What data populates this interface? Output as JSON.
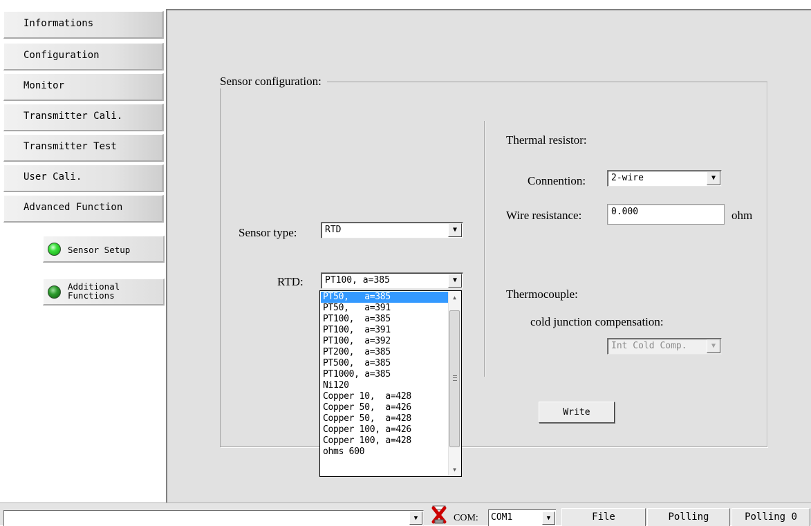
{
  "nav": {
    "items": [
      {
        "label": "Informations"
      },
      {
        "label": "Configuration"
      },
      {
        "label": "Monitor"
      },
      {
        "label": "Transmitter Cali."
      },
      {
        "label": "Transmitter Test"
      },
      {
        "label": "User Cali."
      },
      {
        "label": "Advanced Function"
      }
    ],
    "sub": [
      {
        "label": "Sensor Setup",
        "status": "active"
      },
      {
        "label_line1": "Additional",
        "label_line2": "Functions",
        "status": "inactive"
      }
    ]
  },
  "panel": {
    "title": "Sensor configuration:",
    "sensor_type_label": "Sensor type:",
    "sensor_type_value": "RTD",
    "rtd_label": "RTD:",
    "rtd_value": "PT100,  a=385",
    "rtd_options": [
      "PT50,   a=385",
      "PT50,   a=391",
      "PT100,  a=385",
      "PT100,  a=391",
      "PT100,  a=392",
      "PT200,  a=385",
      "PT500,  a=385",
      "PT1000, a=385",
      "Ni120",
      "Copper 10,  a=428",
      "Copper 50,  a=426",
      "Copper 50,  a=428",
      "Copper 100, a=426",
      "Copper 100, a=428",
      "ohms 600"
    ],
    "rtd_selected_index": 0,
    "thermal_resistor_label": "Thermal resistor:",
    "connection_label": "Connention:",
    "connection_value": "2-wire",
    "wire_resistance_label": "Wire resistance:",
    "wire_resistance_value": "0.000",
    "wire_resistance_unit": "ohm",
    "thermocouple_label": "Thermocouple:",
    "cjc_label": "cold junction compensation:",
    "cjc_value": "Int Cold Comp.",
    "write_label": "Write"
  },
  "statusbar": {
    "com_label": "COM:",
    "com_value": "COM1",
    "file_label": "File",
    "polling_label": "Polling",
    "polling_count": "Polling 0"
  },
  "colors": {
    "selection": "#3399ff",
    "led_on": "#3de03d",
    "disconnect_icon": "#cc0000"
  }
}
